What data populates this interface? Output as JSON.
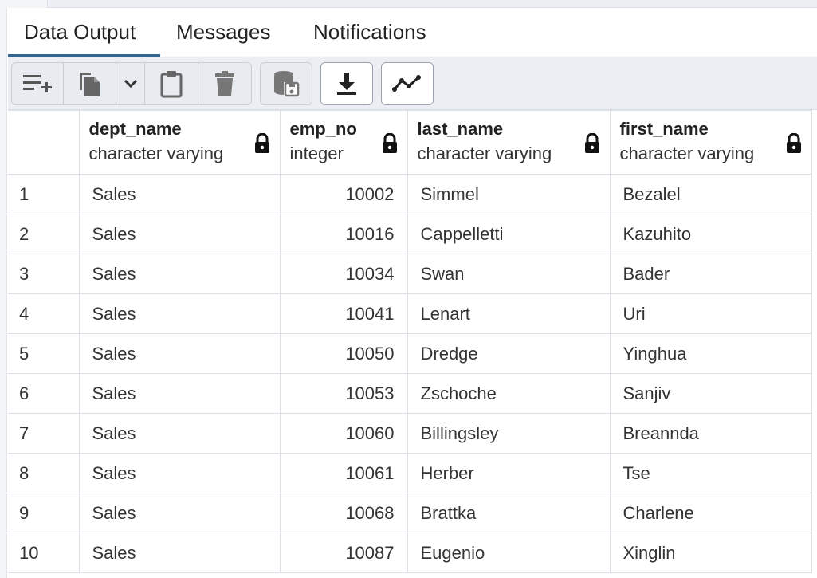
{
  "tabs": [
    {
      "label": "Data Output",
      "active": true
    },
    {
      "label": "Messages",
      "active": false
    },
    {
      "label": "Notifications",
      "active": false
    }
  ],
  "toolbar": {
    "icons": [
      "add-row-icon",
      "copy-icon",
      "chevron-down-icon",
      "paste-icon",
      "delete-icon",
      "save-data-icon",
      "download-icon",
      "graph-icon"
    ]
  },
  "columns": [
    {
      "name": "dept_name",
      "type": "character varying"
    },
    {
      "name": "emp_no",
      "type": "integer"
    },
    {
      "name": "last_name",
      "type": "character varying"
    },
    {
      "name": "first_name",
      "type": "character varying"
    }
  ],
  "rows": [
    {
      "n": "1",
      "dept_name": "Sales",
      "emp_no": "10002",
      "last_name": "Simmel",
      "first_name": "Bezalel"
    },
    {
      "n": "2",
      "dept_name": "Sales",
      "emp_no": "10016",
      "last_name": "Cappelletti",
      "first_name": "Kazuhito"
    },
    {
      "n": "3",
      "dept_name": "Sales",
      "emp_no": "10034",
      "last_name": "Swan",
      "first_name": "Bader"
    },
    {
      "n": "4",
      "dept_name": "Sales",
      "emp_no": "10041",
      "last_name": "Lenart",
      "first_name": "Uri"
    },
    {
      "n": "5",
      "dept_name": "Sales",
      "emp_no": "10050",
      "last_name": "Dredge",
      "first_name": "Yinghua"
    },
    {
      "n": "6",
      "dept_name": "Sales",
      "emp_no": "10053",
      "last_name": "Zschoche",
      "first_name": "Sanjiv"
    },
    {
      "n": "7",
      "dept_name": "Sales",
      "emp_no": "10060",
      "last_name": "Billingsley",
      "first_name": "Breannda"
    },
    {
      "n": "8",
      "dept_name": "Sales",
      "emp_no": "10061",
      "last_name": "Herber",
      "first_name": "Tse"
    },
    {
      "n": "9",
      "dept_name": "Sales",
      "emp_no": "10068",
      "last_name": "Brattka",
      "first_name": "Charlene"
    },
    {
      "n": "10",
      "dept_name": "Sales",
      "emp_no": "10087",
      "last_name": "Eugenio",
      "first_name": "Xinglin"
    }
  ],
  "colors": {
    "accent": "#326690",
    "toolbar_bg": "#ebeef3",
    "border": "#dde0e6"
  }
}
